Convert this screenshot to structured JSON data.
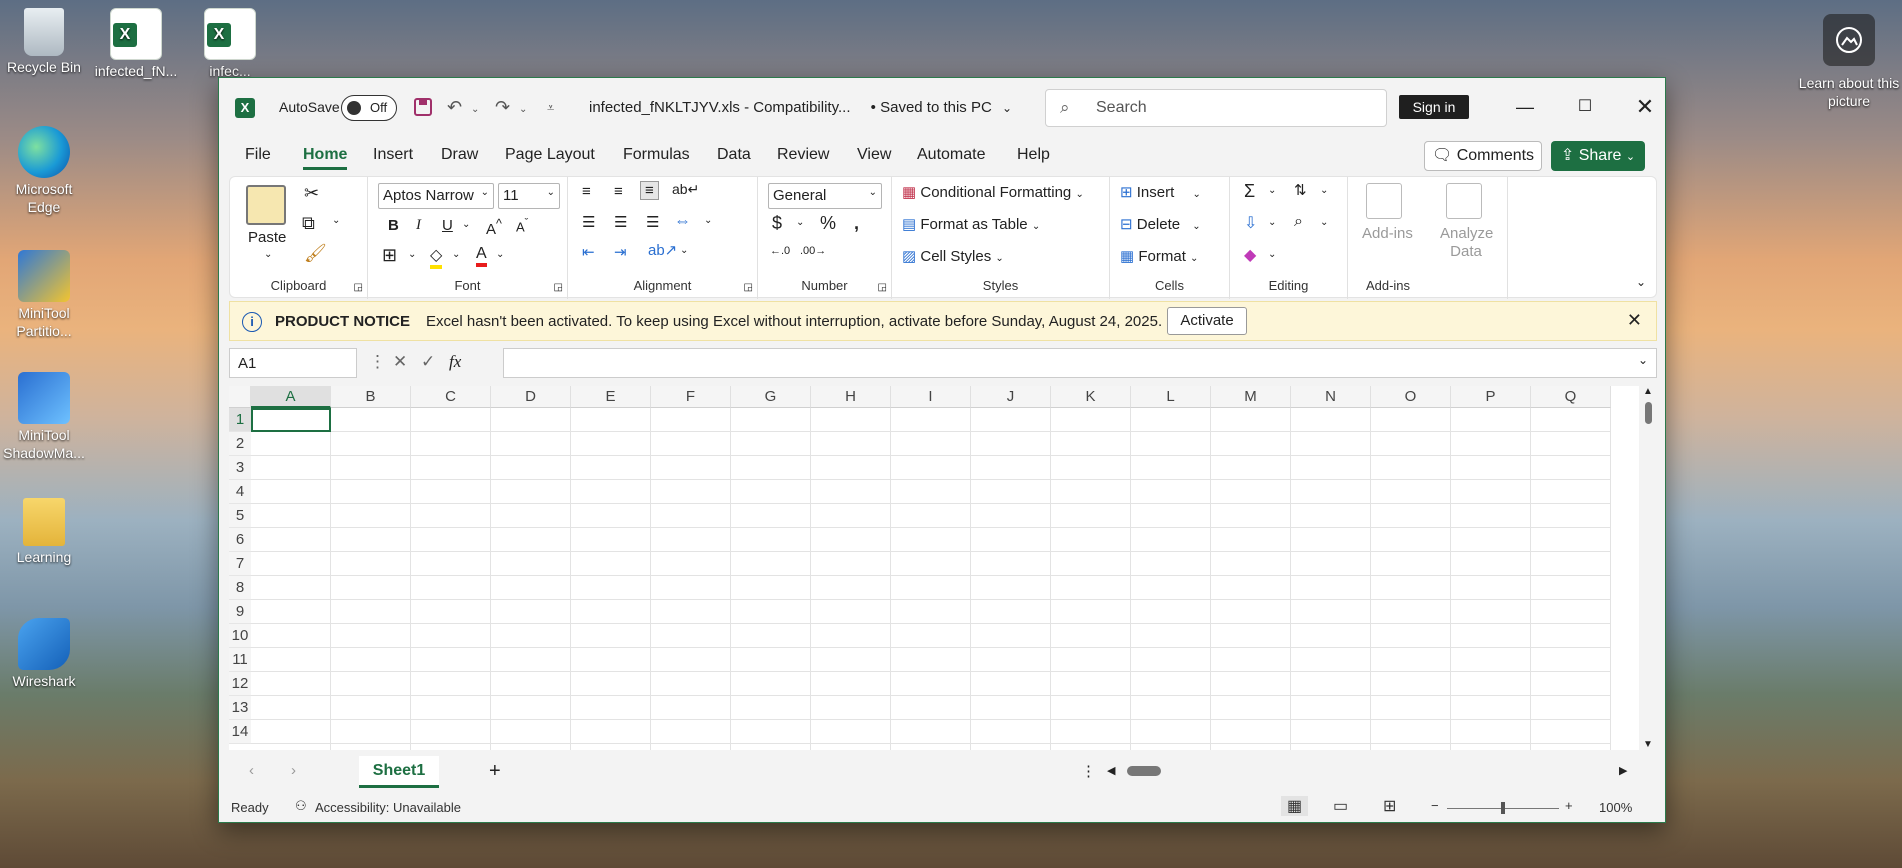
{
  "desktop": {
    "icons": [
      {
        "label": "Recycle Bin",
        "icon": "recycle-bin-icon"
      },
      {
        "label": "infected_fN...",
        "icon": "excel-file-icon"
      },
      {
        "label": "infec...",
        "icon": "excel-file-icon"
      },
      {
        "label": "Microsoft Edge",
        "icon": "edge-icon"
      },
      {
        "label": "MiniTool Partitio...",
        "icon": "minitool-partition-icon"
      },
      {
        "label": "MiniTool ShadowMa...",
        "icon": "minitool-shadowmaker-icon"
      },
      {
        "label": "Learning",
        "icon": "folder-icon"
      },
      {
        "label": "Wireshark",
        "icon": "wireshark-icon"
      }
    ],
    "learn_about": "Learn about this picture"
  },
  "titlebar": {
    "autosave_label": "AutoSave",
    "autosave_state": "Off",
    "doc_title": "infected_fNKLTJYV.xls  -  Compatibility...",
    "save_status": "•  Saved to this PC",
    "search_placeholder": "Search",
    "signin": "Sign in"
  },
  "menu": {
    "tabs": [
      "File",
      "Home",
      "Insert",
      "Draw",
      "Page Layout",
      "Formulas",
      "Data",
      "Review",
      "View",
      "Automate",
      "Help"
    ],
    "active": "Home",
    "comments": "Comments",
    "share": "Share"
  },
  "ribbon": {
    "clipboard": {
      "label": "Clipboard",
      "paste": "Paste"
    },
    "font": {
      "label": "Font",
      "family": "Aptos Narrow",
      "size": "11"
    },
    "alignment": {
      "label": "Alignment"
    },
    "number": {
      "label": "Number",
      "format": "General"
    },
    "styles": {
      "label": "Styles",
      "conditional": "Conditional Formatting",
      "format_table": "Format as Table",
      "cell_styles": "Cell Styles"
    },
    "cells": {
      "label": "Cells",
      "insert": "Insert",
      "delete": "Delete",
      "format": "Format"
    },
    "editing": {
      "label": "Editing"
    },
    "addins": {
      "label": "Add-ins",
      "addins_btn": "Add-ins",
      "analyze": "Analyze Data"
    }
  },
  "notice": {
    "title": "PRODUCT NOTICE",
    "message": "Excel hasn't been activated. To keep using Excel without interruption, activate before Sunday, August 24, 2025.",
    "activate": "Activate"
  },
  "formula_bar": {
    "name_box": "A1",
    "fx": "fx",
    "value": ""
  },
  "grid": {
    "columns": [
      "A",
      "B",
      "C",
      "D",
      "E",
      "F",
      "G",
      "H",
      "I",
      "J",
      "K",
      "L",
      "M",
      "N",
      "O",
      "P",
      "Q"
    ],
    "rows": [
      "1",
      "2",
      "3",
      "4",
      "5",
      "6",
      "7",
      "8",
      "9",
      "10",
      "11",
      "12",
      "13",
      "14"
    ]
  },
  "sheets": {
    "tabs": [
      "Sheet1"
    ],
    "add": "+"
  },
  "status": {
    "ready": "Ready",
    "accessibility": "Accessibility: Unavailable",
    "zoom": "100%"
  }
}
